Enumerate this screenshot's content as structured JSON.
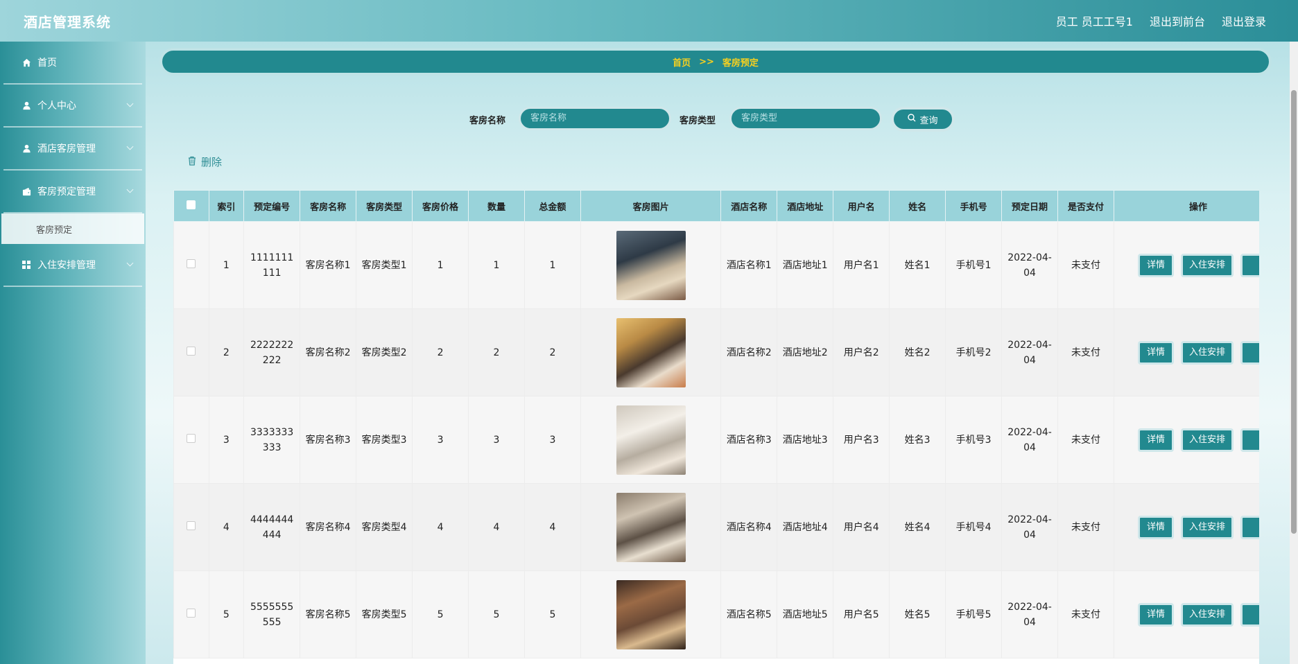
{
  "header": {
    "title": "酒店管理系统",
    "user": "员工 员工工号1",
    "to_front": "退出到前台",
    "logout": "退出登录"
  },
  "sidebar": {
    "items": [
      {
        "label": "首页",
        "icon": "home-icon"
      },
      {
        "label": "个人中心",
        "icon": "user-icon"
      },
      {
        "label": "酒店客房管理",
        "icon": "user-icon"
      },
      {
        "label": "客房预定管理",
        "icon": "wallet-icon"
      },
      {
        "label": "入住安排管理",
        "icon": "grid-icon"
      }
    ],
    "sub_item": "客房预定"
  },
  "breadcrumb": {
    "home": "首页",
    "sep": ">>",
    "current": "客房预定"
  },
  "search": {
    "room_name_label": "客房名称",
    "room_name_placeholder": "客房名称",
    "room_type_label": "客房类型",
    "room_type_placeholder": "客房类型",
    "button": "查询"
  },
  "actions": {
    "delete": "删除"
  },
  "table": {
    "headers": [
      "索引",
      "预定编号",
      "客房名称",
      "客房类型",
      "客房价格",
      "数量",
      "总金额",
      "客房图片",
      "酒店名称",
      "酒店地址",
      "用户名",
      "姓名",
      "手机号",
      "预定日期",
      "是否支付",
      "操作"
    ],
    "rows": [
      {
        "index": "1",
        "code": "1111111111",
        "room_name": "客房名称1",
        "room_type": "客房类型1",
        "price": "1",
        "qty": "1",
        "total": "1",
        "hotel_name": "酒店名称1",
        "hotel_addr": "酒店地址1",
        "username": "用户名1",
        "name": "姓名1",
        "phone": "手机号1",
        "date": "2022-04-04",
        "paid": "未支付"
      },
      {
        "index": "2",
        "code": "2222222222",
        "room_name": "客房名称2",
        "room_type": "客房类型2",
        "price": "2",
        "qty": "2",
        "total": "2",
        "hotel_name": "酒店名称2",
        "hotel_addr": "酒店地址2",
        "username": "用户名2",
        "name": "姓名2",
        "phone": "手机号2",
        "date": "2022-04-04",
        "paid": "未支付"
      },
      {
        "index": "3",
        "code": "3333333333",
        "room_name": "客房名称3",
        "room_type": "客房类型3",
        "price": "3",
        "qty": "3",
        "total": "3",
        "hotel_name": "酒店名称3",
        "hotel_addr": "酒店地址3",
        "username": "用户名3",
        "name": "姓名3",
        "phone": "手机号3",
        "date": "2022-04-04",
        "paid": "未支付"
      },
      {
        "index": "4",
        "code": "4444444444",
        "room_name": "客房名称4",
        "room_type": "客房类型4",
        "price": "4",
        "qty": "4",
        "total": "4",
        "hotel_name": "酒店名称4",
        "hotel_addr": "酒店地址4",
        "username": "用户名4",
        "name": "姓名4",
        "phone": "手机号4",
        "date": "2022-04-04",
        "paid": "未支付"
      },
      {
        "index": "5",
        "code": "5555555555",
        "room_name": "客房名称5",
        "room_type": "客房类型5",
        "price": "5",
        "qty": "5",
        "total": "5",
        "hotel_name": "酒店名称5",
        "hotel_addr": "酒店地址5",
        "username": "用户名5",
        "name": "姓名5",
        "phone": "手机号5",
        "date": "2022-04-04",
        "paid": "未支付"
      }
    ],
    "op_labels": {
      "detail": "详情",
      "checkin": "入住安排"
    }
  },
  "colors": {
    "accent": "#22898f",
    "header_bg": "#99d3da",
    "breadcrumb_text": "#f5d020"
  }
}
